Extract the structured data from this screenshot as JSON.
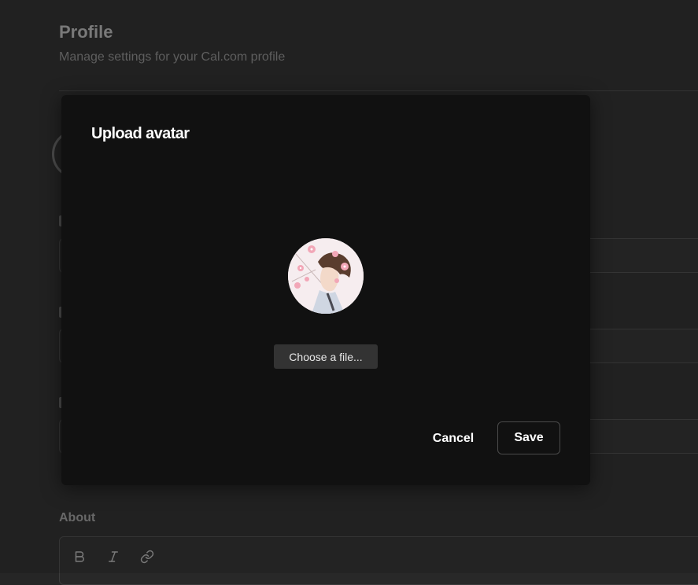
{
  "page": {
    "title": "Profile",
    "subtitle": "Manage settings for your Cal.com profile",
    "about_label": "About"
  },
  "editor_toolbar": {
    "icons": [
      "bold-icon",
      "italic-icon",
      "link-icon"
    ],
    "bold_glyph": "B",
    "italic_glyph": "I"
  },
  "modal": {
    "title": "Upload avatar",
    "choose_file_label": "Choose a file...",
    "cancel_label": "Cancel",
    "save_label": "Save"
  },
  "colors": {
    "page_background": "#262626",
    "modal_background": "#111111",
    "button_background": "#333333",
    "primary_text": "#ffffff"
  }
}
